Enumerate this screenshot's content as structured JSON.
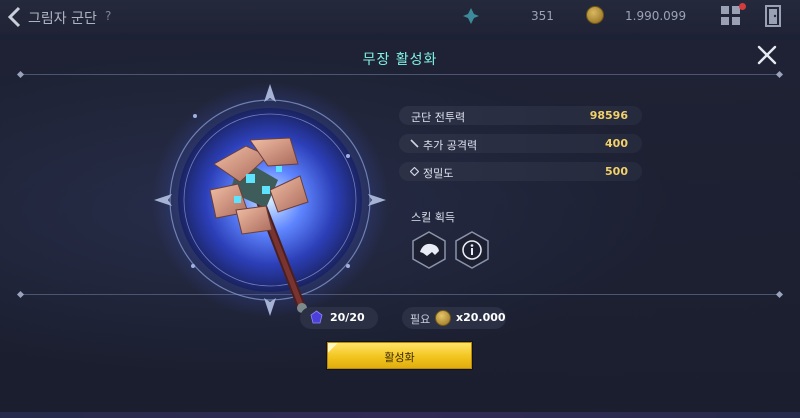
{
  "topbar": {
    "title": "그림자 군단",
    "help": "?",
    "resource_value": "351",
    "gold_value": "1.990.099"
  },
  "modal": {
    "title": "무장 활성화"
  },
  "stats": [
    {
      "label": "군단 전투력",
      "value": "98596",
      "icon": ""
    },
    {
      "label": "추가 공격력",
      "value": "400",
      "icon": "sword-icon"
    },
    {
      "label": "정밀도",
      "value": "500",
      "icon": "diamond-icon"
    }
  ],
  "skills": {
    "title": "스킬 획득",
    "items": [
      {
        "icon": "beast-skill-icon"
      },
      {
        "icon": "info-icon"
      }
    ]
  },
  "cost": {
    "shard_count": "20/20",
    "required_label": "필요",
    "gold_required": "x20.000"
  },
  "activate_button": {
    "label": "활성화"
  },
  "colors": {
    "title_accent": "#7ff2e4",
    "stat_value": "#f2d06b",
    "button_gold": "#f2c51f",
    "emblem_glow": "#3f62ff"
  }
}
